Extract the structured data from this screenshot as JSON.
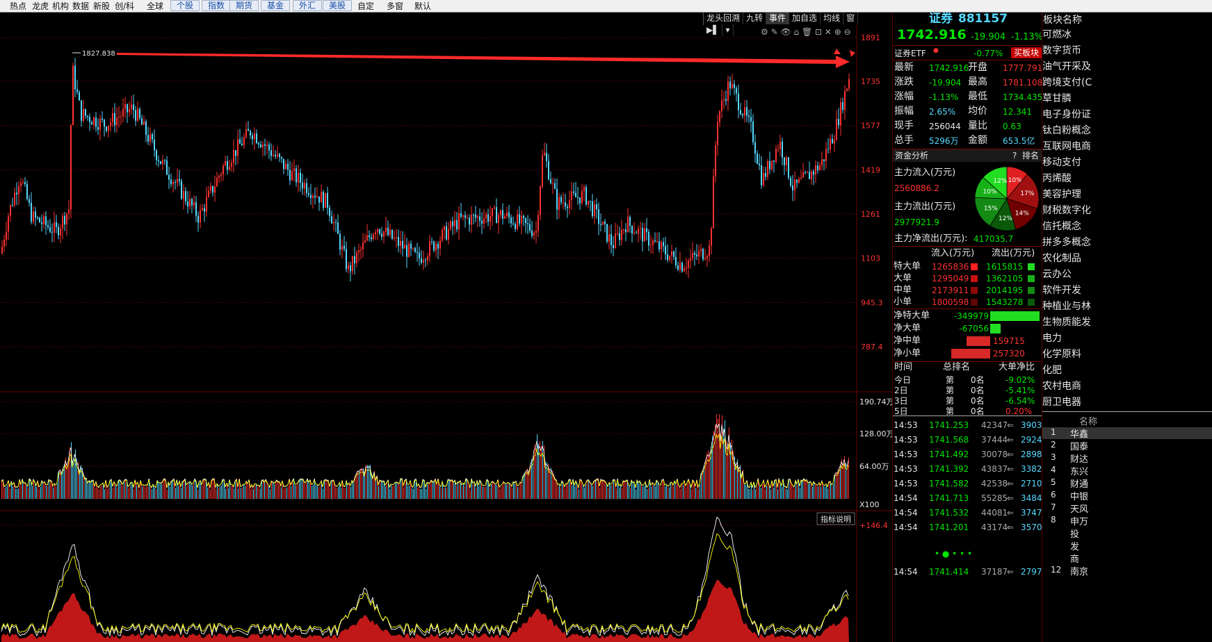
{
  "topnav": {
    "items": [
      "热点",
      "龙虎",
      "机构",
      "数据",
      "新股",
      "创/科",
      "全球"
    ],
    "tabs": [
      "个股",
      "指数",
      "期货",
      "基金",
      "外汇",
      "美股"
    ],
    "items2": [
      "自定",
      "多窗",
      "默认"
    ]
  },
  "toolbar": {
    "items": [
      "龙头回溯",
      "九转",
      "事件",
      "加自选",
      "均线",
      "窗"
    ],
    "active": "事件"
  },
  "chart_data": [
    {
      "type": "candlestick",
      "title": "",
      "y_axis_ticks": [
        "1891",
        "1735",
        "1577",
        "1419",
        "1261",
        "1103",
        "945.3",
        "787.4"
      ],
      "peak_label": "1827.838",
      "annotation": "red arrow from peak 1827.838 to latest price",
      "color_up": "#ff3232",
      "color_down": "#56d9ff",
      "last_close": 1742.916
    },
    {
      "type": "bar",
      "title": "",
      "y_axis_ticks": [
        "190.74万",
        "128.00万",
        "64.00万"
      ],
      "unit_label": "X100"
    },
    {
      "type": "area",
      "title": "",
      "button": "指标说明",
      "y_axis_ticks": [
        "+146.4"
      ]
    }
  ],
  "quote": {
    "name": "证券",
    "code": "881157",
    "price": "1742.916",
    "change": "-19.904",
    "change_pct": "-1.13%",
    "etf_label": "证券ETF",
    "etf_pct": "-0.77%",
    "buy_btn": "买板块",
    "rows": [
      {
        "l1": "最新",
        "v1": "1742.916",
        "l2": "开盘",
        "v2": "1777.791",
        "c1": "grn",
        "c2": "red"
      },
      {
        "l1": "涨跌",
        "v1": "-19.904",
        "l2": "最高",
        "v2": "1781.108",
        "c1": "grn",
        "c2": "red"
      },
      {
        "l1": "涨幅",
        "v1": "-1.13%",
        "l2": "最低",
        "v2": "1734.435",
        "c1": "grn",
        "c2": "grn"
      },
      {
        "l1": "振幅",
        "v1": "2.65%",
        "l2": "均价",
        "v2": "12.341",
        "c1": "cyan",
        "c2": "grn"
      },
      {
        "l1": "现手",
        "v1": "256044",
        "l2": "量比",
        "v2": "0.63",
        "c1": "wht",
        "c2": "grn"
      },
      {
        "l1": "总手",
        "v1": "5296万",
        "l2": "金额",
        "v2": "653.5亿",
        "c1": "cyan",
        "c2": "cyan"
      }
    ],
    "fund_title": "资金分析",
    "fund_q": "?",
    "fund_rank": "排名",
    "inflow_label": "主力流入(万元)",
    "inflow_val": "2560886.2",
    "outflow_label": "主力流出(万元)",
    "outflow_val": "2977921.9",
    "net_label": "主力净流出(万元):",
    "net_val": "417035.7",
    "pie": [
      {
        "label": "10%",
        "color": "#e02020"
      },
      {
        "label": "17%",
        "color": "#a01010"
      },
      {
        "label": "14%",
        "color": "#700000"
      },
      {
        "label": "12%",
        "color": "#0a5a0a"
      },
      {
        "label": "15%",
        "color": "#138a13"
      },
      {
        "label": "10%",
        "color": "#18b018"
      },
      {
        "label": "12%",
        "color": "#22dd22"
      }
    ],
    "flow_head_in": "流入(万元)",
    "flow_head_out": "流出(万元)",
    "flows": [
      {
        "label": "特大单",
        "in": "1265836",
        "out": "1615815"
      },
      {
        "label": "大单",
        "in": "1295049",
        "out": "1362105"
      },
      {
        "label": "中单",
        "in": "2173911",
        "out": "2014195"
      },
      {
        "label": "小单",
        "in": "1800598",
        "out": "1543278"
      }
    ],
    "nets": [
      {
        "label": "净特大单",
        "val": "-349979",
        "sign": "neg",
        "frac": 0.95
      },
      {
        "label": "净大单",
        "val": "-67056",
        "sign": "neg",
        "frac": 0.2
      },
      {
        "label": "净中单",
        "val": "159715",
        "sign": "pos",
        "frac": 0.45
      },
      {
        "label": "净小单",
        "val": "257320",
        "sign": "pos",
        "frac": 0.75
      }
    ],
    "rank_head": [
      "时间",
      "总排名",
      "大单净比"
    ],
    "ranks": [
      {
        "d": "今日",
        "t": "第",
        "n": "0名",
        "p": "-9.02%",
        "c": "grn"
      },
      {
        "d": "2日",
        "t": "第",
        "n": "0名",
        "p": "-5.41%",
        "c": "grn"
      },
      {
        "d": "3日",
        "t": "第",
        "n": "0名",
        "p": "-6.54%",
        "c": "grn"
      },
      {
        "d": "5日",
        "t": "第",
        "n": "0名",
        "p": "0.20%",
        "c": "red"
      }
    ],
    "ticks": [
      {
        "t": "14:53",
        "p": "1741.253",
        "v": "42347",
        "n": "3903"
      },
      {
        "t": "14:53",
        "p": "1741.568",
        "v": "37444",
        "n": "2924"
      },
      {
        "t": "14:53",
        "p": "1741.492",
        "v": "30078",
        "n": "2898"
      },
      {
        "t": "14:53",
        "p": "1741.392",
        "v": "43837",
        "n": "3382"
      },
      {
        "t": "14:53",
        "p": "1741.582",
        "v": "42538",
        "n": "2710"
      },
      {
        "t": "14:54",
        "p": "1741.713",
        "v": "55285",
        "n": "3484"
      },
      {
        "t": "14:54",
        "p": "1741.532",
        "v": "44081",
        "n": "3747"
      },
      {
        "t": "14:54",
        "p": "1741.201",
        "v": "43174",
        "n": "3570"
      },
      {
        "t": "14:54",
        "p": "1741.414",
        "v": "37187",
        "n": "2797"
      }
    ]
  },
  "sectors": {
    "title": "板块名称",
    "items": [
      "可燃冰",
      "数字货币",
      "油气开采及",
      "跨境支付(C",
      "草甘膦",
      "电子身份证",
      "钛白粉概念",
      "互联网电商",
      "移动支付",
      "丙烯酸",
      "美容护理",
      "财税数字化",
      "信托概念",
      "拼多多概念",
      "农化制品",
      "云办公",
      "软件开发",
      "种植业与林",
      "生物质能发",
      "电力",
      "化学原料",
      "化肥",
      "农村电商",
      "厨卫电器"
    ],
    "stocks_head": "名称",
    "stocks": [
      {
        "n": "1",
        "name": "华鑫"
      },
      {
        "n": "2",
        "name": "国泰"
      },
      {
        "n": "3",
        "name": "财达"
      },
      {
        "n": "4",
        "name": "东兴"
      },
      {
        "n": "5",
        "name": "财通"
      },
      {
        "n": "6",
        "name": "中银"
      },
      {
        "n": "7",
        "name": "天风"
      },
      {
        "n": "8",
        "name": "申万"
      },
      {
        "n": "",
        "name": "投"
      },
      {
        "n": "",
        "name": "发"
      },
      {
        "n": "",
        "name": "商"
      },
      {
        "n": "12",
        "name": "南京"
      }
    ]
  }
}
